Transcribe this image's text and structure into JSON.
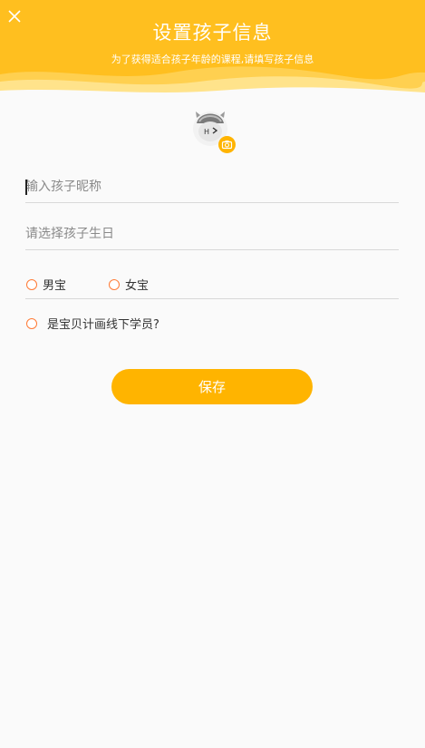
{
  "header": {
    "title": "设置孩子信息",
    "subtitle": "为了获得适合孩子年龄的课程,请填写孩子信息"
  },
  "form": {
    "nickname_placeholder": "输入孩子昵称",
    "nickname_value": "",
    "birthday_placeholder": "请选择孩子生日",
    "gender_options": [
      "男宝",
      "女宝"
    ],
    "student_question": "是宝贝计画线下学员?",
    "save_label": "保存"
  },
  "colors": {
    "header_bg": "#ffbf1f",
    "accent": "#ffb400",
    "radio_border": "#ff7a35"
  },
  "icons": {
    "close": "close-icon",
    "avatar": "child-avatar-icon",
    "camera": "camera-icon"
  }
}
